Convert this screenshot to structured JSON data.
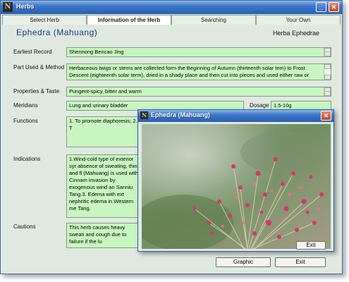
{
  "window": {
    "title": "Herbs",
    "app_icon_letter": "N"
  },
  "tabs": [
    "Select Herb",
    "Information of the Herb",
    "Searching",
    "Your Own"
  ],
  "active_tab": 1,
  "herb": {
    "name": "Ephedra (Mahuang)",
    "latin": "Herba Ephedrae"
  },
  "fields": {
    "earliest_record": {
      "label": "Earliest Record",
      "value": "Shennong Bencao Jing"
    },
    "part_used": {
      "label": "Part Used & Method",
      "value": "Herbaceous twigs or stems are collected form the Beginning of Autumn (thirteenth solar tem) to Frost Descent (eighteenth solar term), dried in a shady place and then cut into pieces and used either raw or baked with honey."
    },
    "properties": {
      "label": "Properties & Taste",
      "value": "Pungent-spicy, bitter and warm"
    },
    "meridians": {
      "label": "Meridians",
      "value": "Lung and urinary bladder"
    },
    "dosage": {
      "label": "Dosage",
      "value": "1.5-10g"
    },
    "functions": {
      "label": "Functions",
      "value": "1. To promote diaphoresis; 2. T"
    },
    "indications": {
      "label": "Indications",
      "value": "1.Wind-cold type of exterior syr absence of sweating, thin and fl (Mahuang) is used with Cinnam invasion by exogenous wind an Sanniu Tang.3. Edema with ext nephritic edema in Western me Tang."
    },
    "cautions": {
      "label": "Cautions",
      "value": "This herb causes heavy sweati and cough due to failure if the lu"
    }
  },
  "buttons": {
    "graphic": "Graphic",
    "exit": "Exit"
  },
  "popup": {
    "title": "Ephedra (Mahuang)",
    "exit": "Exit",
    "close_glyph": "✕"
  },
  "titlebar_glyphs": {
    "minimize": "_",
    "close": "✕"
  },
  "colors": {
    "field_bg": "#c8f6c0",
    "title_blue": "#2a5fb3",
    "herb_name": "#1d3a8a"
  }
}
